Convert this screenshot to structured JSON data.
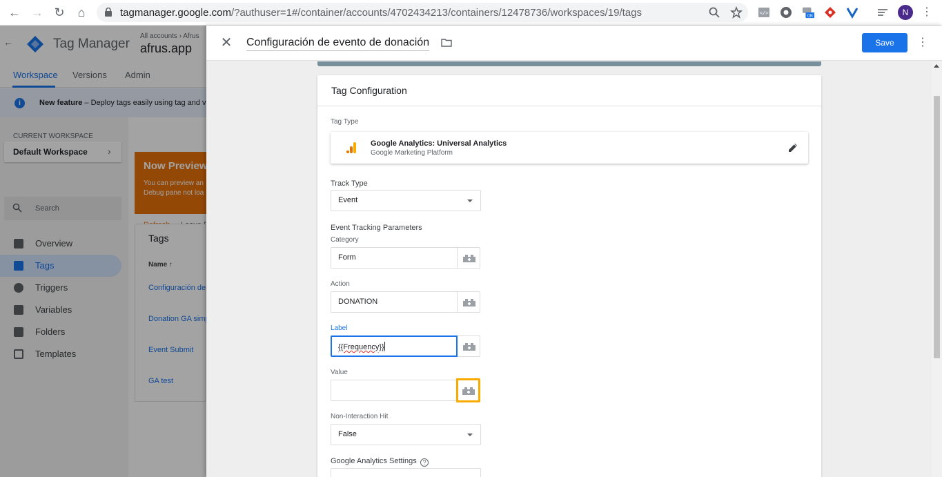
{
  "browser": {
    "url_host": "tagmanager.google.com",
    "url_path": "/?authuser=1#/container/accounts/4702434213/containers/12478736/workspaces/19/tags",
    "profile_initial": "N"
  },
  "gtm": {
    "product_name": "Tag Manager",
    "breadcrumb": "All accounts › Afrus",
    "container_name": "afrus.app",
    "tabs": [
      "Workspace",
      "Versions",
      "Admin"
    ],
    "notice_bold": "New feature",
    "notice_text": "– Deploy tags easily using tag and var",
    "current_workspace_label": "CURRENT WORKSPACE",
    "workspace_name": "Default Workspace",
    "search_placeholder": "Search",
    "sidebar": [
      {
        "label": "Overview",
        "icon": "briefcase-icon"
      },
      {
        "label": "Tags",
        "icon": "tag-icon",
        "active": true
      },
      {
        "label": "Triggers",
        "icon": "trigger-icon"
      },
      {
        "label": "Variables",
        "icon": "variables-icon"
      },
      {
        "label": "Folders",
        "icon": "folder-icon"
      },
      {
        "label": "Templates",
        "icon": "template-icon"
      }
    ],
    "preview_title": "Now Preview",
    "preview_text_1": "You can preview an",
    "preview_text_2": "Debug pane not loa",
    "preview_refresh": "Refresh",
    "preview_leave": "Leave P",
    "tags_title": "Tags",
    "tags_col_name": "Name",
    "tags_rows": [
      "Configuración de",
      "Donation GA simp",
      "Event Submit",
      "GA test"
    ]
  },
  "panel": {
    "title": "Configuración de evento de donación",
    "save_label": "Save",
    "card_title": "Tag Configuration",
    "tag_type_label": "Tag Type",
    "tag_type_name": "Google Analytics: Universal Analytics",
    "tag_type_sub": "Google Marketing Platform",
    "track_type_label": "Track Type",
    "track_type_value": "Event",
    "event_params_label": "Event Tracking Parameters",
    "category_label": "Category",
    "category_value": "Form",
    "action_label": "Action",
    "action_value": "DONATION",
    "label_label": "Label",
    "label_value": "{{Frequency}}",
    "value_label": "Value",
    "value_value": "",
    "non_interaction_label": "Non-Interaction Hit",
    "non_interaction_value": "False",
    "ga_settings_label": "Google Analytics Settings"
  },
  "colors": {
    "accent": "#1a73e8",
    "highlight": "#f9ab00",
    "preview_orange": "#e8710a"
  }
}
